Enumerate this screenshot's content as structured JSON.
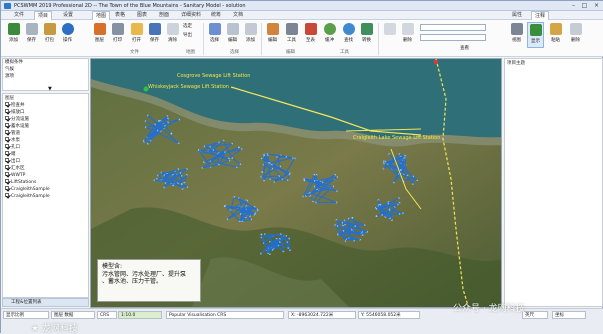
{
  "window": {
    "title": "PCSWMM 2019 Professional 2D -- The Town of the Blue Mountains - Sanitary Model - solution"
  },
  "left_tabs": [
    "文件",
    "项目",
    "设置"
  ],
  "main_tabs": [
    "地图",
    "表格",
    "图表",
    "剖面",
    "详细资料",
    "统筹",
    "文档"
  ],
  "right_tabs": [
    "属性",
    "注释"
  ],
  "left_ribbon": [
    {
      "label": "添加"
    },
    {
      "label": "保存"
    },
    {
      "label": "打包"
    },
    {
      "label": "操作"
    }
  ],
  "main_ribbon": [
    {
      "label": "图层"
    },
    {
      "label": "打印"
    },
    {
      "label": "打开"
    },
    {
      "label": "保存"
    },
    {
      "label": "清除"
    },
    {
      "label": "选定"
    },
    {
      "label": "导出"
    },
    {
      "label": "选择"
    },
    {
      "label": "编辑"
    },
    {
      "label": "添加"
    },
    {
      "label": "编辑"
    },
    {
      "label": "工具"
    },
    {
      "label": "至表"
    },
    {
      "label": "缓冲"
    },
    {
      "label": "查找"
    },
    {
      "label": "转换"
    },
    {
      "label": "删除"
    }
  ],
  "main_groups": [
    "文件",
    "地图",
    "选择",
    "编辑",
    "工具",
    "选择"
  ],
  "ribbon_combo_label": "查看",
  "right_ribbon": [
    {
      "label": "视图"
    },
    {
      "label": "显示"
    },
    {
      "label": "粘贴"
    },
    {
      "label": "删除"
    }
  ],
  "left_panel": {
    "scenario_items": [
      "模拟条件",
      "气候",
      "源项"
    ],
    "layers_title": "图层",
    "layers": [
      {
        "label": "检查井",
        "checked": true
      },
      {
        "label": "排放口",
        "checked": true
      },
      {
        "label": "分流设施",
        "checked": true
      },
      {
        "label": "蓄水设施",
        "checked": true
      },
      {
        "label": "管道",
        "checked": true
      },
      {
        "label": "水泵",
        "checked": true
      },
      {
        "label": "孔口",
        "checked": true
      },
      {
        "label": "堰",
        "checked": true
      },
      {
        "label": "出口",
        "checked": true
      },
      {
        "label": "汇水区",
        "checked": true
      },
      {
        "label": "WWTP",
        "checked": true
      },
      {
        "label": "LiftStations",
        "checked": true
      },
      {
        "label": "CraigleithSample",
        "checked": true
      },
      {
        "label": "CraigleithSample",
        "checked": true
      }
    ],
    "bottom_label": "工程&位置列表"
  },
  "right_panel": {
    "title": "项目主题"
  },
  "map_labels": [
    "Cosgrove Sewage Lift Station",
    "Whiskeyjack Sewage Lift Station",
    "Craigleith Lake Sewage Lift Station"
  ],
  "callout_lines": [
    "模型含:",
    "污水管网、污水处理厂、提升泵",
    "、蓄水池、压力干管。"
  ],
  "status": {
    "scale_label": "显示比例",
    "scale_value": "1:10.0",
    "crs": "Popular Visualisation CRS",
    "x": "X: -8963024.722米",
    "y": "Y: 5546058.052米",
    "units": "英尺",
    "mode": "坐标",
    "layer_select": "图层 数据"
  },
  "watermark": "公众号 · 龙网科技",
  "colors": {
    "pipe": "#1f6fd6",
    "forcemain": "#f3e55a",
    "label": "#f1ea3f"
  }
}
